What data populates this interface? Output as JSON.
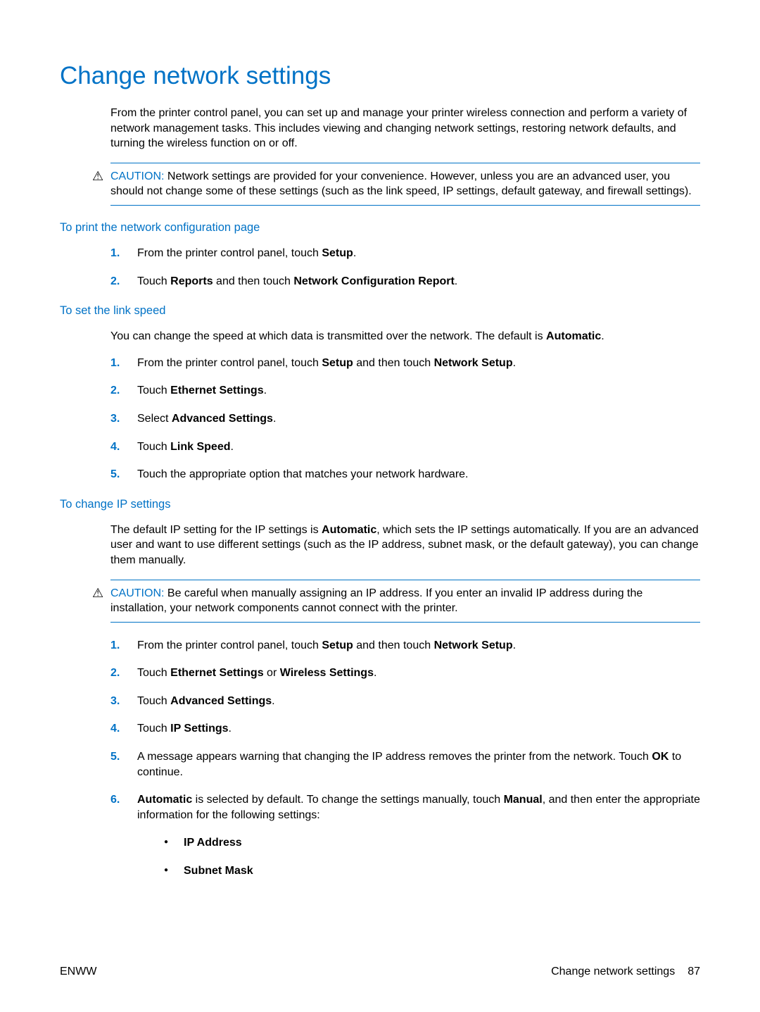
{
  "title": "Change network settings",
  "intro": "From the printer control panel, you can set up and manage your printer wireless connection and perform a variety of network management tasks. This includes viewing and changing network settings, restoring network defaults, and turning the wireless function on or off.",
  "caution1": {
    "label": "CAUTION:",
    "text": "Network settings are provided for your convenience. However, unless you are an advanced user, you should not change some of these settings (such as the link speed, IP settings, default gateway, and firewall settings)."
  },
  "section1": {
    "heading": "To print the network configuration page",
    "steps": [
      {
        "num": "1.",
        "pre": "From the printer control panel, touch ",
        "b1": "Setup",
        "post": "."
      },
      {
        "num": "2.",
        "pre": "Touch ",
        "b1": "Reports",
        "mid": " and then touch ",
        "b2": "Network Configuration Report",
        "post": "."
      }
    ]
  },
  "section2": {
    "heading": "To set the link speed",
    "intro_pre": "You can change the speed at which data is transmitted over the network. The default is ",
    "intro_b": "Automatic",
    "intro_post": ".",
    "steps": [
      {
        "num": "1.",
        "pre": "From the printer control panel, touch ",
        "b1": "Setup",
        "mid": " and then touch ",
        "b2": "Network Setup",
        "post": "."
      },
      {
        "num": "2.",
        "pre": "Touch ",
        "b1": "Ethernet Settings",
        "post": "."
      },
      {
        "num": "3.",
        "pre": "Select ",
        "b1": "Advanced Settings",
        "post": "."
      },
      {
        "num": "4.",
        "pre": "Touch ",
        "b1": "Link Speed",
        "post": "."
      },
      {
        "num": "5.",
        "pre": "Touch the appropriate option that matches your network hardware.",
        "b1": "",
        "post": ""
      }
    ]
  },
  "section3": {
    "heading": "To change IP settings",
    "intro_pre": "The default IP setting for the IP settings is ",
    "intro_b": "Automatic",
    "intro_post": ", which sets the IP settings automatically. If you are an advanced user and want to use different settings (such as the IP address, subnet mask, or the default gateway), you can change them manually.",
    "caution": {
      "label": "CAUTION:",
      "text": "Be careful when manually assigning an IP address. If you enter an invalid IP address during the installation, your network components cannot connect with the printer."
    },
    "steps": {
      "s1": {
        "num": "1.",
        "pre": "From the printer control panel, touch ",
        "b1": "Setup",
        "mid": " and then touch ",
        "b2": "Network Setup",
        "post": "."
      },
      "s2": {
        "num": "2.",
        "pre": "Touch ",
        "b1": "Ethernet Settings",
        "mid": " or ",
        "b2": "Wireless Settings",
        "post": "."
      },
      "s3": {
        "num": "3.",
        "pre": "Touch ",
        "b1": "Advanced Settings",
        "post": "."
      },
      "s4": {
        "num": "4.",
        "pre": "Touch ",
        "b1": "IP Settings",
        "post": "."
      },
      "s5": {
        "num": "5.",
        "pre": "A message appears warning that changing the IP address removes the printer from the network. Touch ",
        "b1": "OK",
        "post": " to continue."
      },
      "s6": {
        "num": "6.",
        "b1": "Automatic",
        "mid": " is selected by default. To change the settings manually, touch ",
        "b2": "Manual",
        "post": ", and then enter the appropriate information for the following settings:"
      }
    },
    "sub": {
      "a": "IP Address",
      "b": "Subnet Mask"
    }
  },
  "footer": {
    "left": "ENWW",
    "right_text": "Change network settings",
    "page": "87"
  }
}
